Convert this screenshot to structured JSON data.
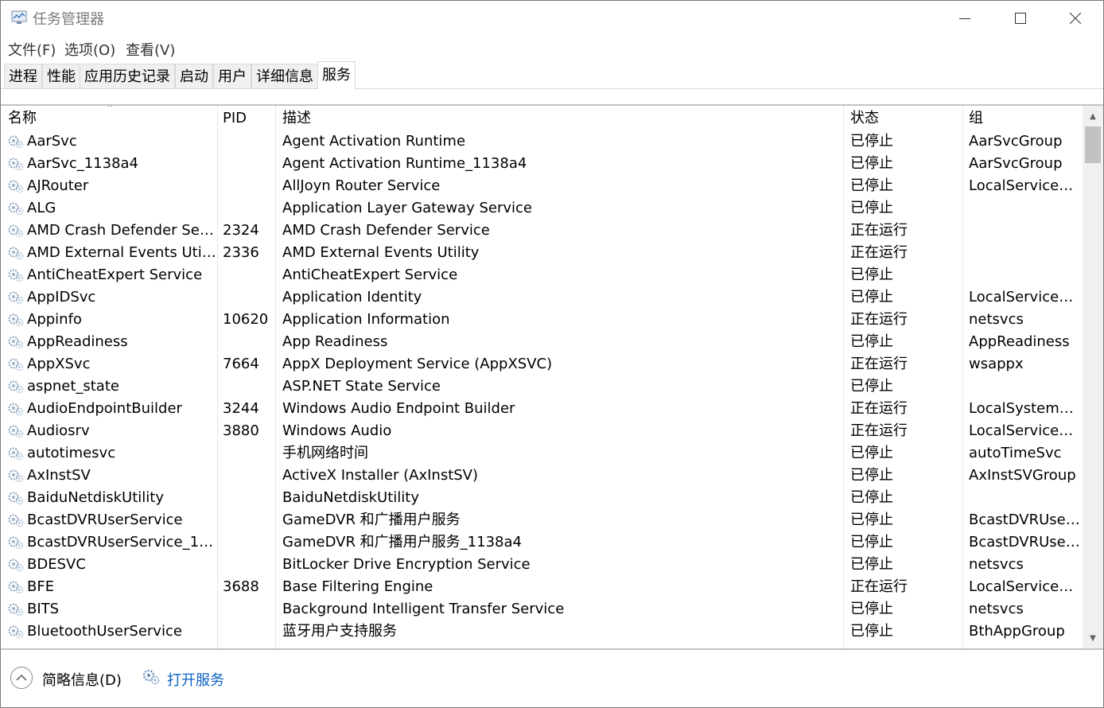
{
  "window": {
    "title": "任务管理器"
  },
  "menu": [
    "文件(F)",
    "选项(O)",
    "查看(V)"
  ],
  "tabs": [
    {
      "label": "进程"
    },
    {
      "label": "性能"
    },
    {
      "label": "应用历史记录"
    },
    {
      "label": "启动"
    },
    {
      "label": "用户"
    },
    {
      "label": "详细信息"
    },
    {
      "label": "服务",
      "active": true
    }
  ],
  "columns": [
    "名称",
    "PID",
    "描述",
    "状态",
    "组"
  ],
  "sort": {
    "column": "名称",
    "direction": "ascending"
  },
  "rows": [
    [
      "AarSvc",
      "",
      "Agent Activation Runtime",
      "已停止",
      "AarSvcGroup"
    ],
    [
      "AarSvc_1138a4",
      "",
      "Agent Activation Runtime_1138a4",
      "已停止",
      "AarSvcGroup"
    ],
    [
      "AJRouter",
      "",
      "AllJoyn Router Service",
      "已停止",
      "LocalServiceN..."
    ],
    [
      "ALG",
      "",
      "Application Layer Gateway Service",
      "已停止",
      ""
    ],
    [
      "AMD Crash Defender Serv...",
      "2324",
      "AMD Crash Defender Service",
      "正在运行",
      ""
    ],
    [
      "AMD External Events Utility",
      "2336",
      "AMD External Events Utility",
      "正在运行",
      ""
    ],
    [
      "AntiCheatExpert Service",
      "",
      "AntiCheatExpert Service",
      "已停止",
      ""
    ],
    [
      "AppIDSvc",
      "",
      "Application Identity",
      "已停止",
      "LocalServiceN..."
    ],
    [
      "Appinfo",
      "10620",
      "Application Information",
      "正在运行",
      "netsvcs"
    ],
    [
      "AppReadiness",
      "",
      "App Readiness",
      "已停止",
      "AppReadiness"
    ],
    [
      "AppXSvc",
      "7664",
      "AppX Deployment Service (AppXSVC)",
      "正在运行",
      "wsappx"
    ],
    [
      "aspnet_state",
      "",
      "ASP.NET State Service",
      "已停止",
      ""
    ],
    [
      "AudioEndpointBuilder",
      "3244",
      "Windows Audio Endpoint Builder",
      "正在运行",
      "LocalSystemN..."
    ],
    [
      "Audiosrv",
      "3880",
      "Windows Audio",
      "正在运行",
      "LocalServiceN..."
    ],
    [
      "autotimesvc",
      "",
      "手机网络时间",
      "已停止",
      "autoTimeSvc"
    ],
    [
      "AxInstSV",
      "",
      "ActiveX Installer (AxInstSV)",
      "已停止",
      "AxInstSVGroup"
    ],
    [
      "BaiduNetdiskUtility",
      "",
      "BaiduNetdiskUtility",
      "已停止",
      ""
    ],
    [
      "BcastDVRUserService",
      "",
      "GameDVR 和广播用户服务",
      "已停止",
      "BcastDVRUser..."
    ],
    [
      "BcastDVRUserService_113...",
      "",
      "GameDVR 和广播用户服务_1138a4",
      "已停止",
      "BcastDVRUser..."
    ],
    [
      "BDESVC",
      "",
      "BitLocker Drive Encryption Service",
      "已停止",
      "netsvcs"
    ],
    [
      "BFE",
      "3688",
      "Base Filtering Engine",
      "正在运行",
      "LocalServiceN..."
    ],
    [
      "BITS",
      "",
      "Background Intelligent Transfer Service",
      "已停止",
      "netsvcs"
    ],
    [
      "BluetoothUserService",
      "",
      "蓝牙用户支持服务",
      "已停止",
      "BthAppGroup"
    ]
  ],
  "footer": {
    "fewer_details": "简略信息(D)",
    "open_services": "打开服务"
  }
}
